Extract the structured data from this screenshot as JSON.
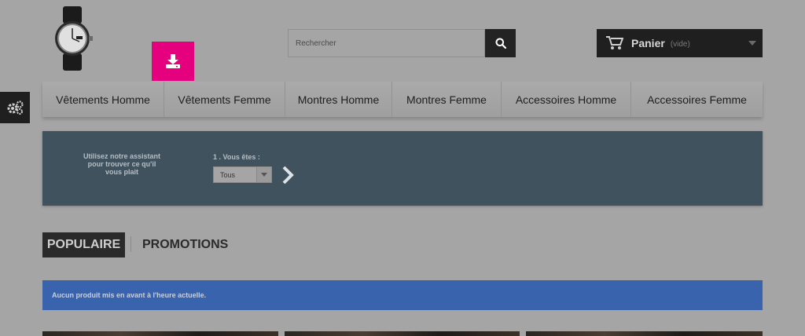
{
  "header": {
    "logo_icon": "wristwatch-logo",
    "download_icon": "download-tray-icon",
    "search": {
      "placeholder": "Rechercher",
      "button_icon": "search-icon"
    },
    "cart": {
      "icon": "cart-icon",
      "label": "Panier",
      "status": "(vide)"
    }
  },
  "sidebar": {
    "gear_icon": "gears-icon"
  },
  "nav": {
    "items": [
      {
        "label": "Vêtements Homme"
      },
      {
        "label": "Vêtements Femme"
      },
      {
        "label": "Montres Homme"
      },
      {
        "label": "Montres Femme"
      },
      {
        "label": "Accessoires Homme"
      },
      {
        "label": "Accessoires Femme"
      }
    ]
  },
  "wizard": {
    "intro": "Utilisez notre assistant pour trouver ce qu'il vous plait",
    "step_label": "1 . Vous êtes :",
    "select_value": "Tous",
    "next_icon": "chevron-right-icon"
  },
  "tabs": {
    "popular": "POPULAIRE",
    "promotions": "PROMOTIONS"
  },
  "notice": {
    "text": "Aucun produit mis en avant à l'heure actuelle."
  },
  "colors": {
    "page_background": "#a5a5a5",
    "download_button": "#e5007d",
    "dark": "#1f1f1f",
    "wizard_background": "#3f525e",
    "notice_background": "#3963ad"
  }
}
